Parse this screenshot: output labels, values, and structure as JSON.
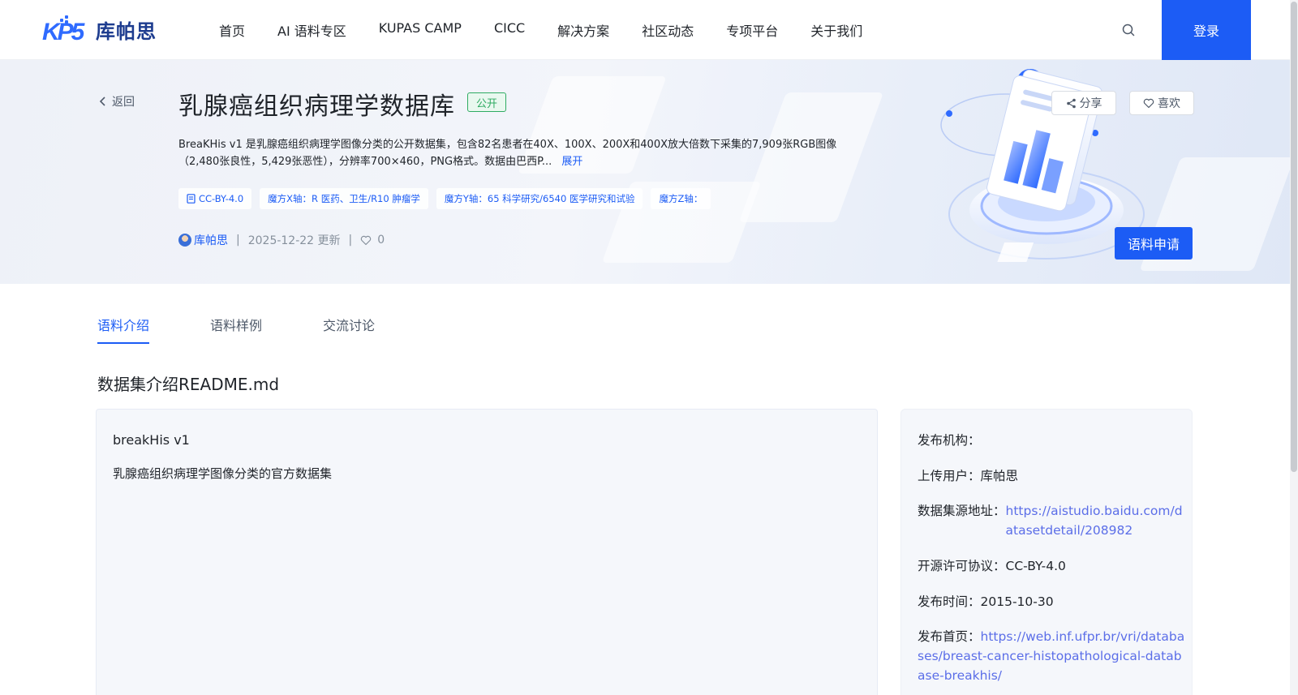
{
  "brand": {
    "logo_text": "库帕思",
    "logo_mark": "KP5"
  },
  "nav": {
    "items": [
      {
        "label": "首页"
      },
      {
        "label": "AI 语料专区"
      },
      {
        "label": "KUPAS CAMP"
      },
      {
        "label": "CICC"
      },
      {
        "label": "解决方案"
      },
      {
        "label": "社区动态"
      },
      {
        "label": "专项平台"
      },
      {
        "label": "关于我们"
      }
    ],
    "search_icon": "search-icon",
    "login_label": "登录"
  },
  "hero": {
    "back_label": "返回",
    "title": "乳腺癌组织病理学数据库",
    "visibility_badge": "公开",
    "description": "BreaKHis v1 是乳腺癌组织病理学图像分类的公开数据集，包含82名患者在40X、100X、200X和400X放大倍数下采集的7,909张RGB图像（2,480张良性，5,429张恶性），分辨率700×460，PNG格式。数据由巴西P...",
    "expand_label": "展开",
    "tags": [
      {
        "label": "CC-BY-4.0",
        "icon": "license-icon"
      },
      {
        "label": "魔方X轴：R 医药、卫生/R10 肿瘤学"
      },
      {
        "label": "魔方Y轴：65 科学研究/6540 医学研究和试验"
      },
      {
        "label": "魔方Z轴："
      }
    ],
    "meta": {
      "uploader": "库帕思",
      "separator": "|",
      "updated": "2025-12-22 更新",
      "likes": "0"
    },
    "share_label": "分享",
    "like_label": "喜欢",
    "apply_label": "语料申请"
  },
  "tabs": [
    {
      "label": "语料介绍",
      "active": true
    },
    {
      "label": "语料样例",
      "active": false
    },
    {
      "label": "交流讨论",
      "active": false
    }
  ],
  "section_title": "数据集介绍README.md",
  "readme": {
    "heading": "breakHis v1",
    "paragraph": "乳腺癌组织病理学图像分类的官方数据集"
  },
  "info": {
    "publisher_label": "发布机构：",
    "publisher_value": "",
    "uploader_label": "上传用户：",
    "uploader_value": "库帕思",
    "source_label": "数据集源地址：",
    "source_value": "https://aistudio.baidu.com/datasetdetail/208982",
    "license_label": "开源许可协议：",
    "license_value": "CC-BY-4.0",
    "date_label": "发布时间：",
    "date_value": "2015-10-30",
    "homepage_label": "发布首页：",
    "homepage_value": "https://web.inf.ufpr.br/vri/databases/breast-cancer-histopathological-database-breakhis/"
  },
  "colors": {
    "primary": "#1c5cf5",
    "badge_green": "#2fab62",
    "link": "#5b6ee8"
  }
}
